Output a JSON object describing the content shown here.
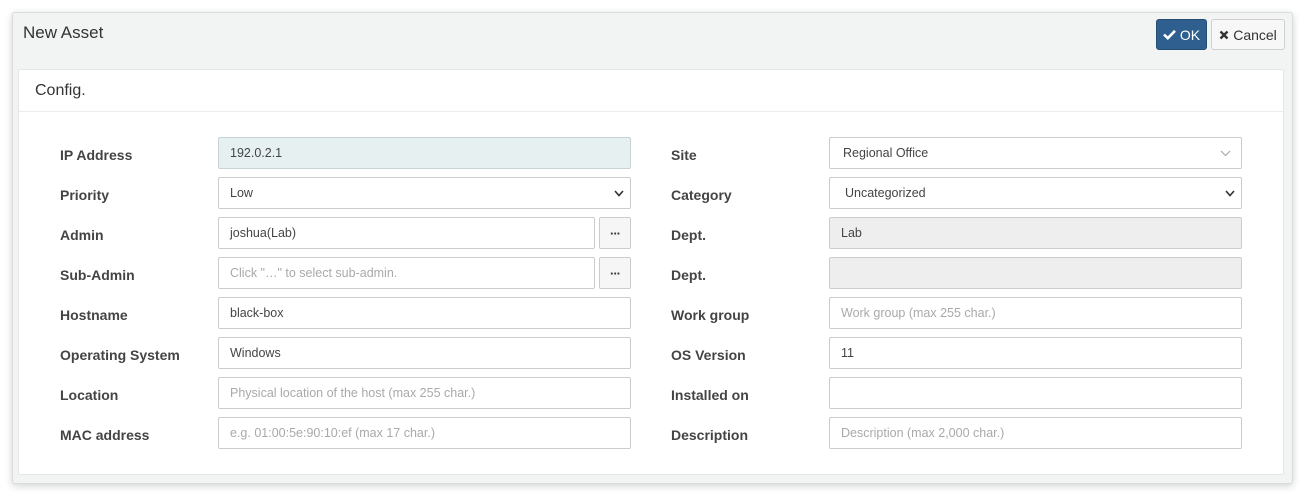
{
  "dialog": {
    "title": "New Asset",
    "ok_label": "OK",
    "cancel_label": "Cancel",
    "ok_color": "#2e5f8e"
  },
  "panel": {
    "title": "Config."
  },
  "left": {
    "ip_address": {
      "label": "IP Address",
      "value": "192.0.2.1"
    },
    "priority": {
      "label": "Priority",
      "value": "Low"
    },
    "admin": {
      "label": "Admin",
      "value": "joshua(Lab)"
    },
    "sub_admin": {
      "label": "Sub-Admin",
      "placeholder": "Click \"…\" to select sub-admin."
    },
    "hostname": {
      "label": "Hostname",
      "value": "black-box"
    },
    "os": {
      "label": "Operating System",
      "value": "Windows"
    },
    "location": {
      "label": "Location",
      "placeholder": "Physical location of the host (max 255 char.)"
    },
    "mac": {
      "label": "MAC address",
      "placeholder": "e.g. 01:00:5e:90:10:ef (max 17 char.)"
    }
  },
  "right": {
    "site": {
      "label": "Site",
      "value": "Regional Office"
    },
    "category": {
      "label": "Category",
      "value": "Uncategorized"
    },
    "dept1": {
      "label": "Dept.",
      "value": "Lab"
    },
    "dept2": {
      "label": "Dept.",
      "value": ""
    },
    "workgroup": {
      "label": "Work group",
      "placeholder": "Work group (max 255 char.)"
    },
    "os_version": {
      "label": "OS Version",
      "value": "11"
    },
    "installed_on": {
      "label": "Installed on",
      "value": ""
    },
    "description": {
      "label": "Description",
      "placeholder": "Description (max 2,000 char.)"
    }
  },
  "icons": {
    "ok": "check-icon",
    "cancel": "close-icon",
    "select": "chevron-down-icon",
    "picker": "ellipsis-icon"
  },
  "picker_label": "···"
}
